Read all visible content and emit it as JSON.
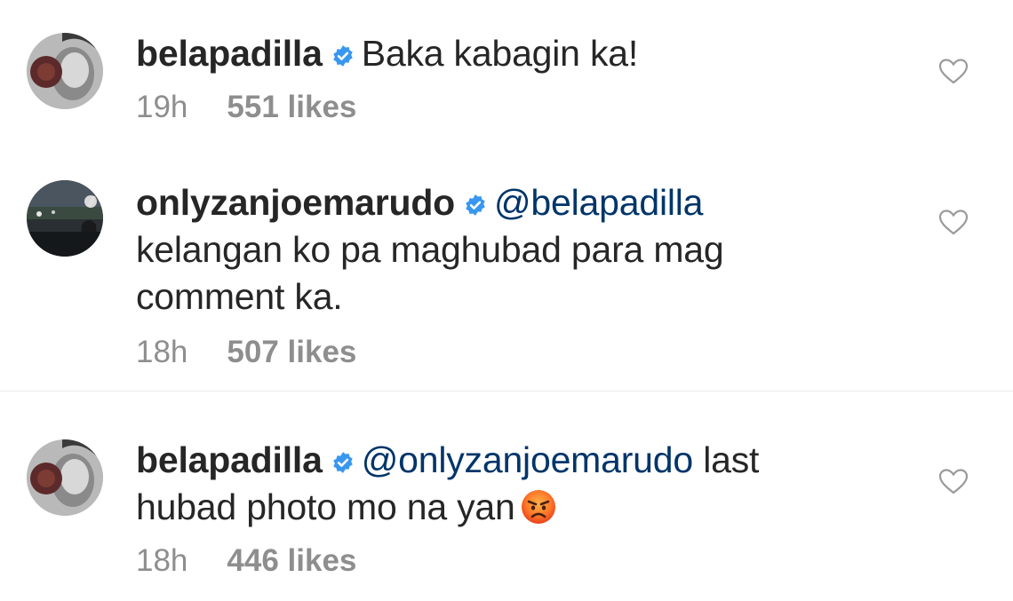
{
  "comments": [
    {
      "username": "belapadilla",
      "mention": "",
      "line1_text": "Baka kabagin ka!",
      "line2_text": "",
      "line3_text": "",
      "time": "19h",
      "likes": "551 likes",
      "avatar_icon": "profile-photo-icon"
    },
    {
      "username": "onlyzanjoemarudo",
      "mention": "@belapadilla",
      "line1_text": "",
      "line2_text": "kelangan ko pa maghubad para mag",
      "line3_text": "comment ka.",
      "time": "18h",
      "likes": "507 likes",
      "avatar_icon": "profile-photo-icon"
    },
    {
      "username": "belapadilla",
      "mention": "@onlyzanjoemarudo",
      "line1_text": "last",
      "line2_text": "hubad photo mo na yan",
      "line3_text": "",
      "time": "18h",
      "likes": "446 likes",
      "avatar_icon": "profile-photo-icon",
      "emoji": "angry-face-emoji"
    }
  ],
  "icons": {
    "verified": "verified-badge-icon",
    "like": "heart-outline-icon"
  },
  "colors": {
    "verified_blue": "#3897f0",
    "mention_blue": "#003569",
    "meta_gray": "#8e8e8e",
    "text": "#262626"
  }
}
